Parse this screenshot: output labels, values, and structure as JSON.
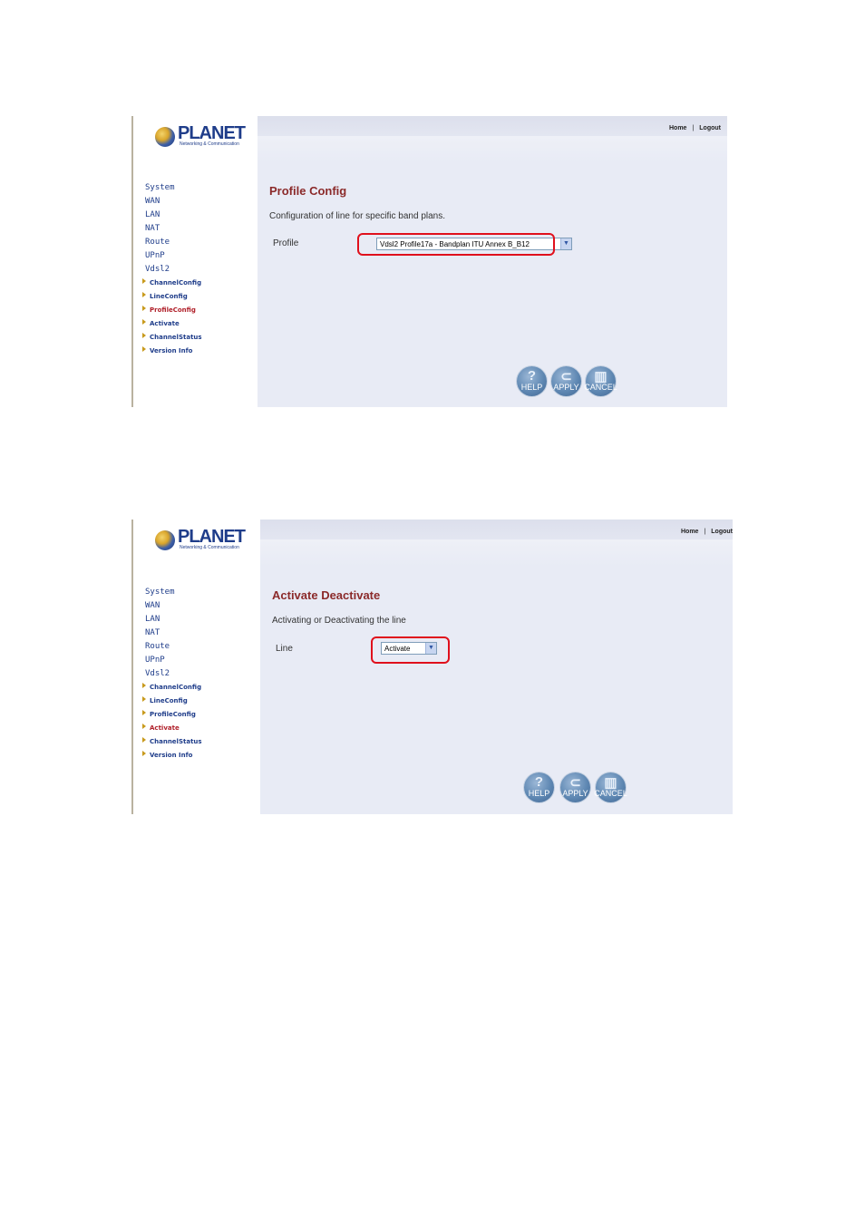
{
  "screens": [
    {
      "logo": {
        "word": "PLANET",
        "tagline": "Networking & Communication"
      },
      "menu": [
        "System",
        "WAN",
        "LAN",
        "NAT",
        "Route",
        "UPnP",
        "Vdsl2"
      ],
      "submenu": [
        {
          "label": "ChannelConfig",
          "active": false
        },
        {
          "label": "LineConfig",
          "active": false
        },
        {
          "label": "ProfileConfig",
          "active": true
        },
        {
          "label": "Activate",
          "active": false
        },
        {
          "label": "ChannelStatus",
          "active": false
        },
        {
          "label": "Version Info",
          "active": false
        }
      ],
      "top_links": {
        "home": "Home",
        "sep": "|",
        "logout": "Logout"
      },
      "title": "Profile Config",
      "description": "Configuration of line for specific band plans.",
      "field_label": "Profile",
      "field_value": "Vdsl2 Profile17a - Bandplan ITU Annex B_B12",
      "buttons": {
        "help": "HELP",
        "apply": "APPLY",
        "cancel": "CANCEL"
      }
    },
    {
      "logo": {
        "word": "PLANET",
        "tagline": "Networking & Communication"
      },
      "menu": [
        "System",
        "WAN",
        "LAN",
        "NAT",
        "Route",
        "UPnP",
        "Vdsl2"
      ],
      "submenu": [
        {
          "label": "ChannelConfig",
          "active": false
        },
        {
          "label": "LineConfig",
          "active": false
        },
        {
          "label": "ProfileConfig",
          "active": false
        },
        {
          "label": "Activate",
          "active": true
        },
        {
          "label": "ChannelStatus",
          "active": false
        },
        {
          "label": "Version Info",
          "active": false
        }
      ],
      "top_links": {
        "home": "Home",
        "sep": "|",
        "logout": "Logout"
      },
      "title": "Activate Deactivate",
      "description": "Activating or Deactivating the line",
      "field_label": "Line",
      "field_value": "Activate",
      "buttons": {
        "help": "HELP",
        "apply": "APPLY",
        "cancel": "CANCEL"
      }
    }
  ],
  "colors": {
    "highlight": "#e0101c",
    "title": "#8b2a2a",
    "menu": "#1f3d8a",
    "active_submenu": "#b0202a"
  },
  "icons": {
    "help": "question-icon",
    "apply": "apply-icon",
    "cancel": "trash-icon",
    "submenu_bullet": "triangle-right-icon"
  }
}
